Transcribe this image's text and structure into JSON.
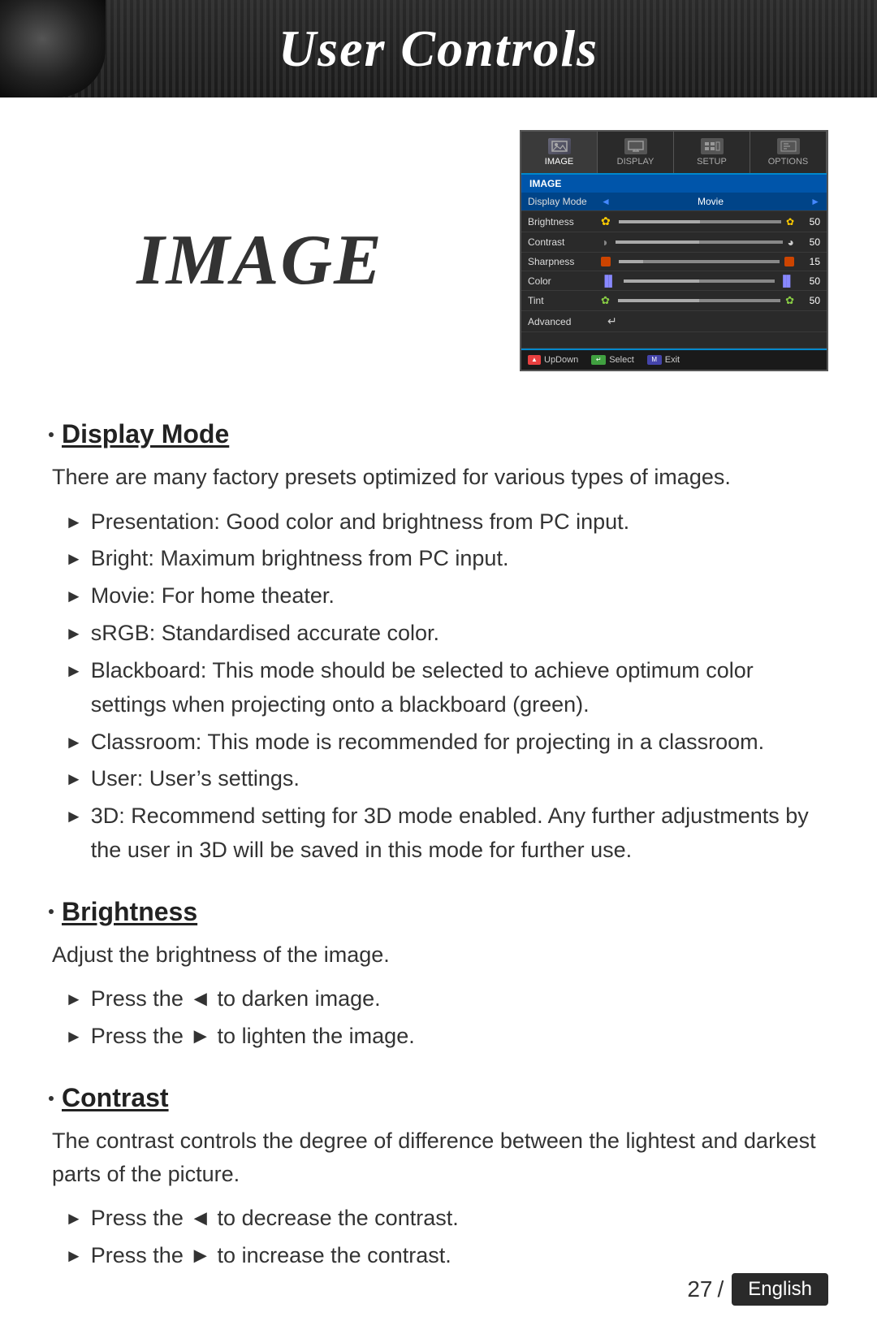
{
  "header": {
    "title": "User Controls"
  },
  "page": {
    "section_title": "IMAGE",
    "page_number": "27",
    "language": "English"
  },
  "menu": {
    "tabs": [
      {
        "label": "IMAGE",
        "active": true
      },
      {
        "label": "DISPLAY",
        "active": false
      },
      {
        "label": "SETUP",
        "active": false
      },
      {
        "label": "OPTIONS",
        "active": false
      }
    ],
    "section_label": "IMAGE",
    "items": [
      {
        "label": "Display Mode",
        "type": "select",
        "value": "Movie",
        "highlighted": true
      },
      {
        "label": "Brightness",
        "type": "slider",
        "value": "50"
      },
      {
        "label": "Contrast",
        "type": "slider",
        "value": "50"
      },
      {
        "label": "Sharpness",
        "type": "slider",
        "value": "15"
      },
      {
        "label": "Color",
        "type": "slider",
        "value": "50"
      },
      {
        "label": "Tint",
        "type": "slider",
        "value": "50"
      },
      {
        "label": "Advanced",
        "type": "enter",
        "value": ""
      }
    ],
    "footer": [
      {
        "icon": "updown",
        "label": "UpDown"
      },
      {
        "icon": "select",
        "label": "Select"
      },
      {
        "icon": "exit",
        "label": "Exit"
      }
    ]
  },
  "sections": [
    {
      "id": "display-mode",
      "heading": "Display Mode",
      "intro": "There are many factory presets optimized for various types of images.",
      "bullets": [
        "Presentation: Good color and brightness from PC input.",
        "Bright: Maximum brightness from PC input.",
        "Movie: For home theater.",
        "sRGB: Standardised accurate color.",
        "Blackboard: This mode should be selected to achieve optimum color settings when projecting onto a blackboard (green).",
        "Classroom: This mode is recommended for projecting in a classroom.",
        "User: User’s settings.",
        "3D: Recommend setting for 3D mode enabled. Any further adjustments by the user in 3D will be saved in this mode for further use."
      ]
    },
    {
      "id": "brightness",
      "heading": "Brightness",
      "intro": "Adjust the brightness of the image.",
      "bullets": [
        "Press the ◄ to darken image.",
        "Press the ► to lighten the image."
      ]
    },
    {
      "id": "contrast",
      "heading": "Contrast",
      "intro": "The contrast controls the degree of difference between the lightest and darkest parts of the picture.",
      "bullets": [
        "Press the ◄ to decrease the contrast.",
        "Press the ► to increase the contrast."
      ]
    }
  ]
}
